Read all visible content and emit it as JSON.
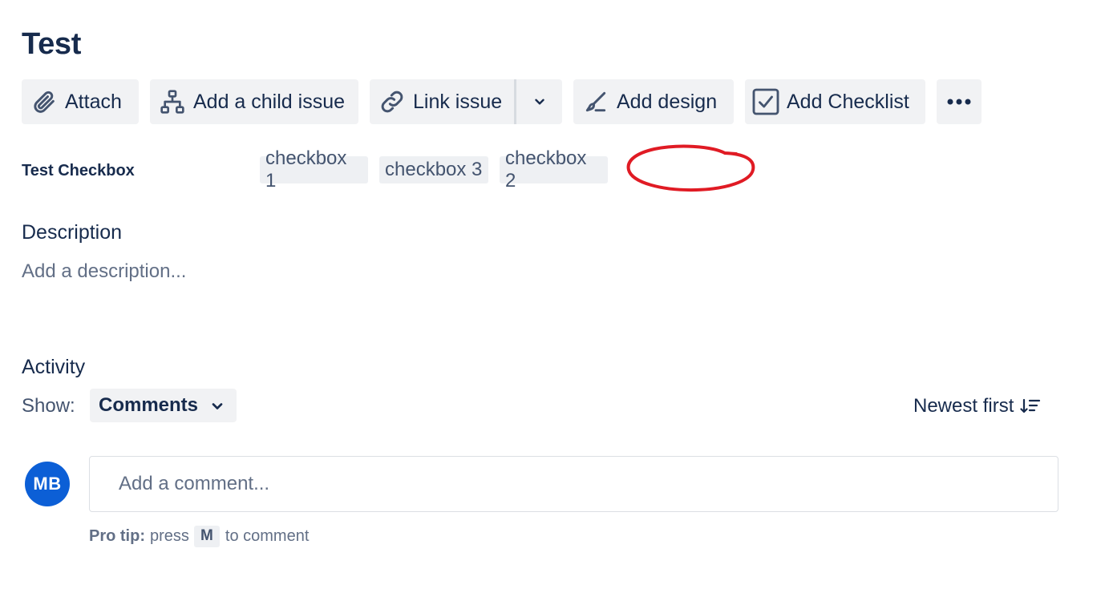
{
  "issue": {
    "title": "Test"
  },
  "toolbar": {
    "attach_label": "Attach",
    "add_child_label": "Add a child issue",
    "link_issue_label": "Link issue",
    "add_design_label": "Add design",
    "add_checklist_label": "Add Checklist",
    "icons": [
      "paperclip-icon",
      "hierarchy-icon",
      "link-icon",
      "chevron-down-icon",
      "design-brush-icon",
      "checkbox-checked-icon",
      "more-horizontal-icon"
    ]
  },
  "fields": {
    "test_checkbox": {
      "label": "Test Checkbox",
      "values": [
        "checkbox 1",
        "checkbox 3",
        "checkbox 2"
      ]
    }
  },
  "annotation": {
    "color": "#e01b24",
    "shape": "hand-drawn-ellipse"
  },
  "description": {
    "heading": "Description",
    "placeholder": "Add a description..."
  },
  "activity": {
    "heading": "Activity",
    "show_label": "Show:",
    "show_value": "Comments",
    "sort_label": "Newest first",
    "avatar_initials": "MB",
    "comment_placeholder": "Add a comment...",
    "pro_tip": {
      "prefix": "Pro tip:",
      "press": "press",
      "key": "M",
      "suffix": "to comment"
    }
  },
  "colors": {
    "text_primary": "#172b4d",
    "text_subtle": "#626f86",
    "button_bg": "#f1f2f4",
    "avatar_bg": "#0c5fd6",
    "annotation": "#e01b24"
  }
}
